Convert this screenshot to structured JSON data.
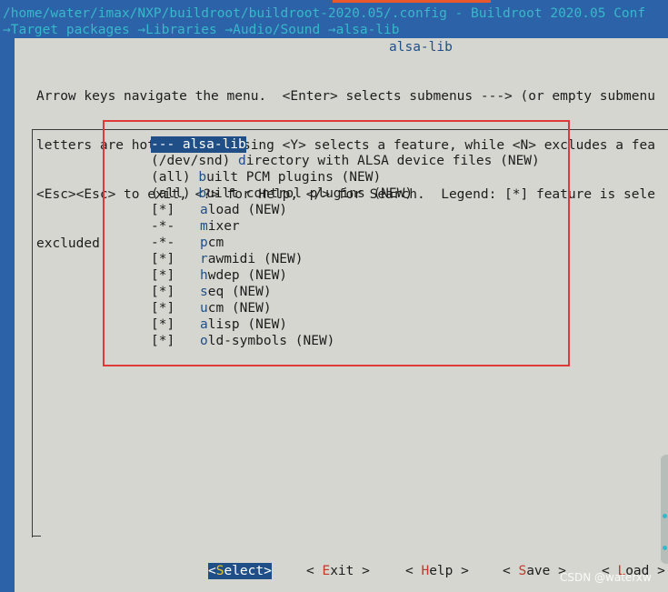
{
  "title_bar": "/home/water/imax/NXP/buildroot/buildroot-2020.05/.config - Buildroot 2020.05 Conf",
  "breadcrumb": "→Target packages →Libraries →Audio/Sound →alsa-lib",
  "window_title": "alsa-lib",
  "help_lines": [
    "Arrow keys navigate the menu.  <Enter> selects submenus ---> (or empty submenu",
    "letters are hotkeys.  Pressing <Y> selects a feature, while <N> excludes a fea",
    "<Esc><Esc> to exit, <?> for Help, </> for Search.  Legend: [*] feature is sele",
    "excluded"
  ],
  "menu_items": [
    {
      "marker": "",
      "text": "--- alsa-lib",
      "selected": true
    },
    {
      "marker": "",
      "text": "(/dev/snd) directory with ALSA device files (NEW)",
      "hotkey": "d"
    },
    {
      "marker": "",
      "text": "(all) built PCM plugins (NEW)",
      "hotkey": "b"
    },
    {
      "marker": "",
      "text": "(all) built control plugins (NEW)",
      "hotkey": "b"
    },
    {
      "marker": "[*]",
      "text": "aload (NEW)",
      "hotkey": "a"
    },
    {
      "marker": "-*-",
      "text": "mixer",
      "hotkey": "m"
    },
    {
      "marker": "-*-",
      "text": "pcm",
      "hotkey": "p"
    },
    {
      "marker": "[*]",
      "text": "rawmidi (NEW)",
      "hotkey": "r"
    },
    {
      "marker": "[*]",
      "text": "hwdep (NEW)",
      "hotkey": "h"
    },
    {
      "marker": "[*]",
      "text": "seq (NEW)",
      "hotkey": "s"
    },
    {
      "marker": "[*]",
      "text": "ucm (NEW)",
      "hotkey": "u"
    },
    {
      "marker": "[*]",
      "text": "alisp (NEW)",
      "hotkey": "a"
    },
    {
      "marker": "[*]",
      "text": "old-symbols (NEW)",
      "hotkey": "o"
    }
  ],
  "buttons": [
    {
      "pre": "<",
      "key": "S",
      "post": "elect>",
      "selected": true
    },
    {
      "pre": "< ",
      "key": "E",
      "post": "xit >",
      "selected": false
    },
    {
      "pre": "< ",
      "key": "H",
      "post": "elp >",
      "selected": false
    },
    {
      "pre": "< ",
      "key": "S",
      "post": "ave >",
      "selected": false
    },
    {
      "pre": "< ",
      "key": "L",
      "post": "oad >",
      "selected": false
    }
  ],
  "watermark": "CSDN @waterxw",
  "colors": {
    "terminal_bg": "#2c62a8",
    "dialog_bg": "#d6d6d0",
    "highlight": "#1f4f86",
    "hotkey": "#1f4f86",
    "annotation_box": "#e0393a"
  }
}
